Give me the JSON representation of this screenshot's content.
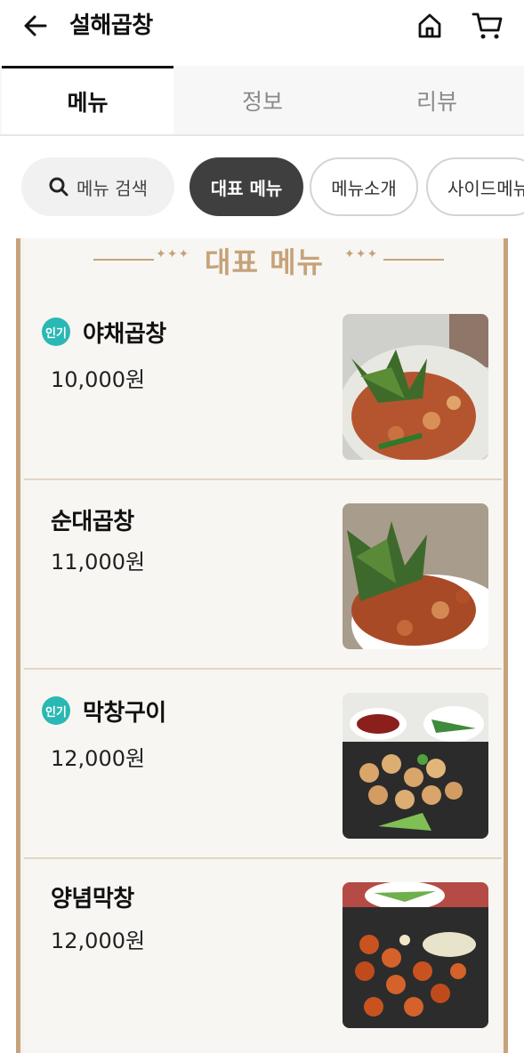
{
  "header": {
    "title": "설해곱창",
    "back_icon": "arrow-left-icon",
    "home_icon": "home-icon",
    "cart_icon": "cart-icon"
  },
  "tabs": [
    {
      "label": "메뉴",
      "active": true
    },
    {
      "label": "정보",
      "active": false
    },
    {
      "label": "리뷰",
      "active": false
    }
  ],
  "chips": {
    "search_label": "메뉴 검색",
    "search_icon": "search-icon",
    "items": [
      {
        "label": "대표 메뉴",
        "selected": true
      },
      {
        "label": "메뉴소개",
        "selected": false
      },
      {
        "label": "사이드메뉴",
        "selected": false
      }
    ]
  },
  "section": {
    "title": "대표 메뉴",
    "accent_color": "#c6a27a"
  },
  "menu_items": [
    {
      "name": "야채곱창",
      "price": "10,000원",
      "badge": "인기"
    },
    {
      "name": "순대곱창",
      "price": "11,000원",
      "badge": ""
    },
    {
      "name": "막창구이",
      "price": "12,000원",
      "badge": "인기"
    },
    {
      "name": "양념막창",
      "price": "12,000원",
      "badge": ""
    }
  ],
  "colors": {
    "badge": "#2ab8b4",
    "chip_selected": "#3f3f3f",
    "border_accent": "#c6a27a"
  }
}
